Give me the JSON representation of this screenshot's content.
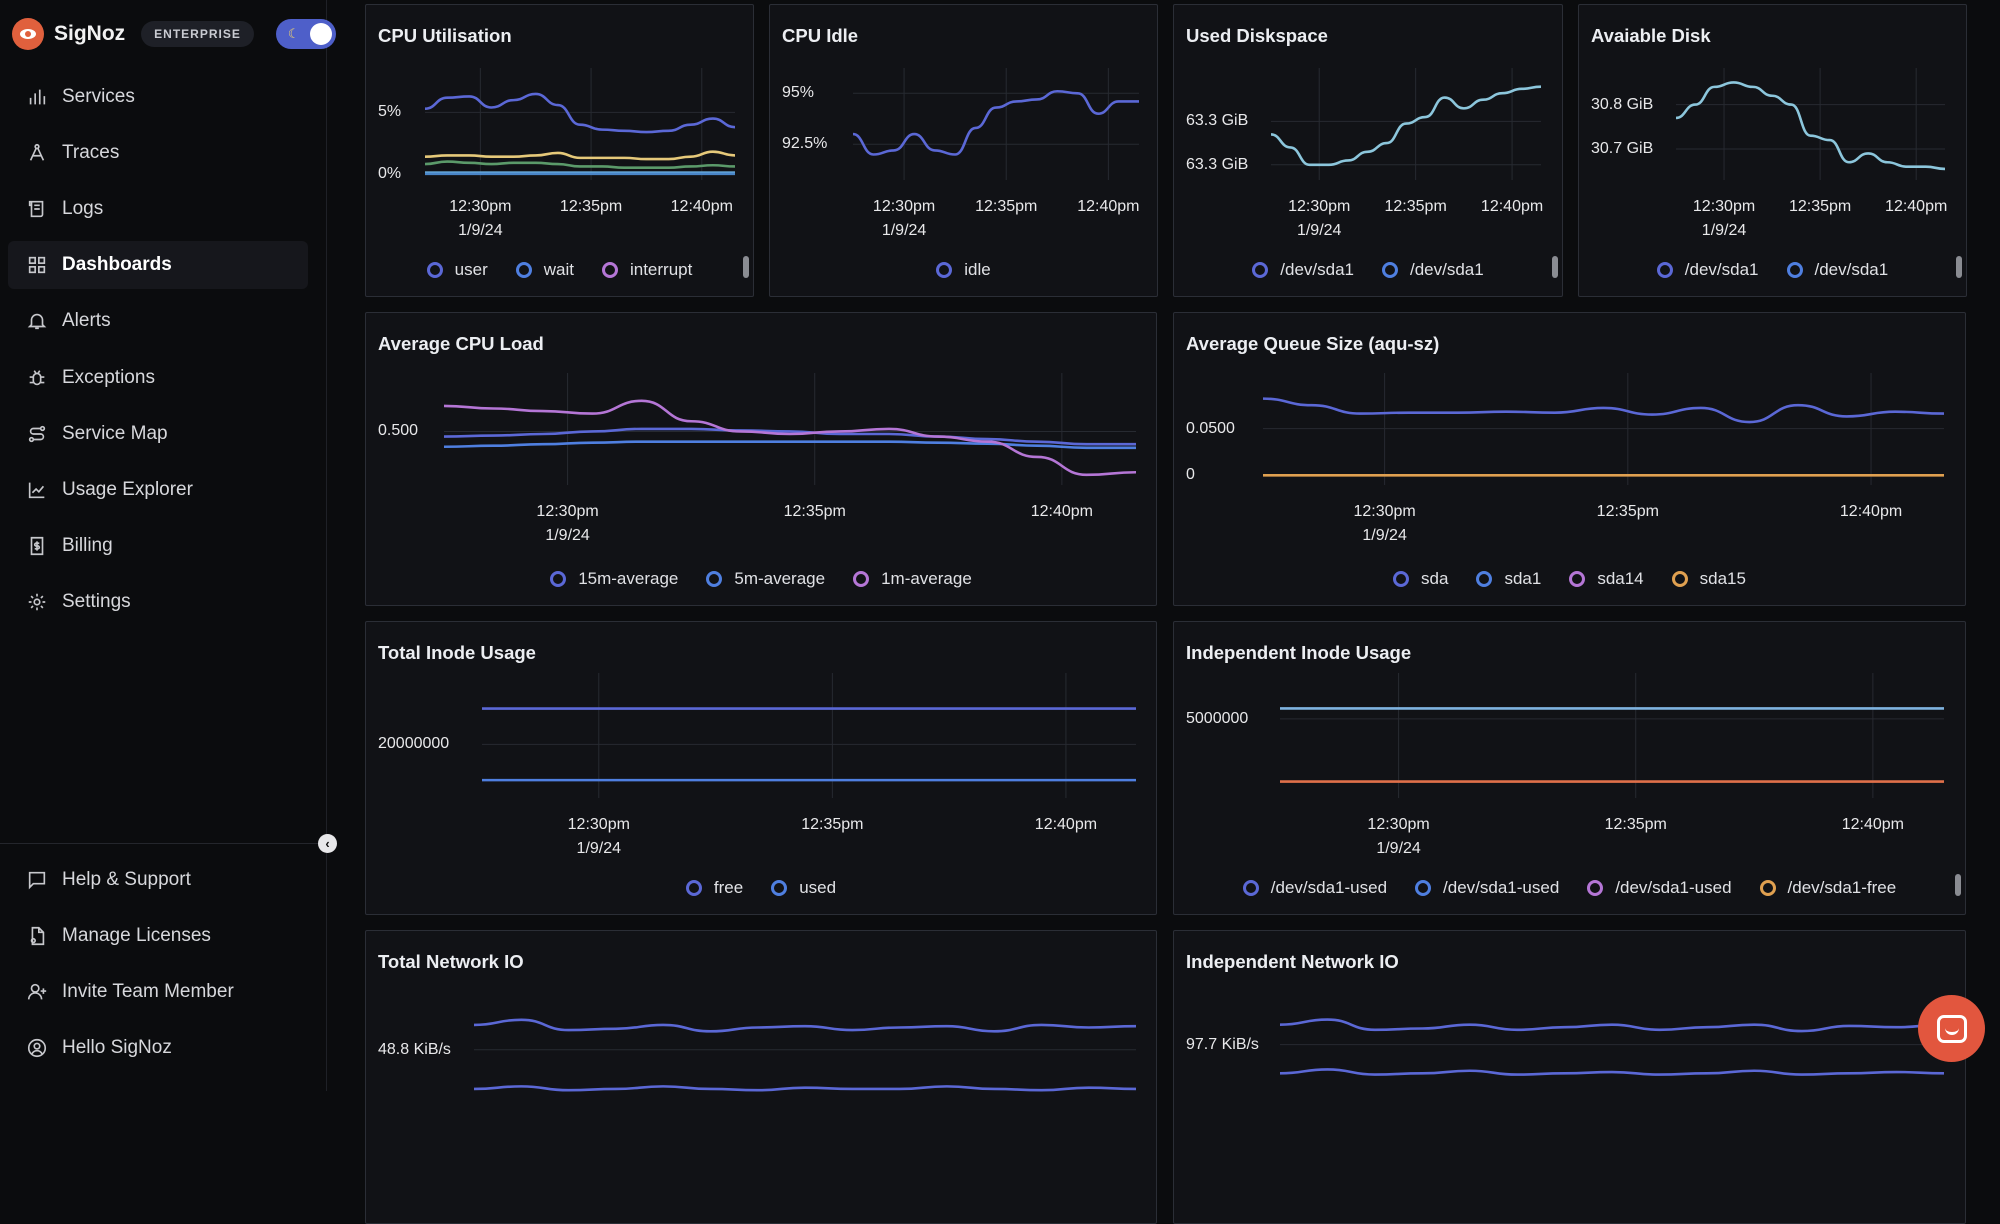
{
  "app": {
    "name": "SigNoz",
    "edition_badge": "ENTERPRISE",
    "theme_toggle_on": true
  },
  "sidebar": {
    "items": [
      {
        "label": "Services",
        "icon": "bar-chart-icon"
      },
      {
        "label": "Traces",
        "icon": "traces-icon"
      },
      {
        "label": "Logs",
        "icon": "scroll-icon"
      },
      {
        "label": "Dashboards",
        "icon": "grid-icon",
        "active": true
      },
      {
        "label": "Alerts",
        "icon": "bell-icon"
      },
      {
        "label": "Exceptions",
        "icon": "bug-icon"
      },
      {
        "label": "Service Map",
        "icon": "route-icon"
      },
      {
        "label": "Usage Explorer",
        "icon": "line-chart-icon"
      },
      {
        "label": "Billing",
        "icon": "receipt-icon"
      },
      {
        "label": "Settings",
        "icon": "gear-icon"
      }
    ],
    "bottom_items": [
      {
        "label": "Help & Support",
        "icon": "message-icon"
      },
      {
        "label": "Manage Licenses",
        "icon": "license-icon"
      },
      {
        "label": "Invite Team Member",
        "icon": "user-plus-icon"
      },
      {
        "label": "Hello SigNoz",
        "icon": "user-circle-icon"
      }
    ]
  },
  "colors": {
    "accent": "#4e5fc9",
    "brand": "#e0603d",
    "panel_bg": "#111216",
    "border": "#2b2e36"
  },
  "chart_data": [
    {
      "type": "line",
      "title": "CPU Utilisation",
      "xlim": [
        "12:27:30",
        "12:41:30"
      ],
      "ylim": [
        -0.5,
        7.8
      ],
      "yticks": [
        {
          "value": 5,
          "label": "5%"
        },
        {
          "value": 0,
          "label": "0%"
        }
      ],
      "xticks": [
        {
          "value": "12:30",
          "label": "12:30pm",
          "sub": "1/9/24"
        },
        {
          "value": "12:35",
          "label": "12:35pm"
        },
        {
          "value": "12:40",
          "label": "12:40pm"
        }
      ],
      "legend": [
        {
          "name": "user",
          "color": "#5b68d6"
        },
        {
          "name": "wait",
          "color": "#4f7fe0"
        },
        {
          "name": "interrupt",
          "color": "#b576d6"
        }
      ],
      "legend_scroll": true,
      "series": [
        {
          "color": "#5b68d6",
          "values": [
            5.3,
            6.2,
            6.3,
            5.4,
            6.0,
            6.5,
            5.6,
            4.0,
            3.6,
            3.5,
            3.4,
            3.5,
            4.0,
            4.5,
            3.8
          ]
        },
        {
          "color": "#e6c97a",
          "values": [
            1.4,
            1.5,
            1.5,
            1.4,
            1.4,
            1.5,
            1.7,
            1.3,
            1.3,
            1.3,
            1.2,
            1.2,
            1.4,
            1.8,
            1.5
          ]
        },
        {
          "color": "#5b9a6a",
          "values": [
            0.8,
            1.0,
            0.9,
            0.8,
            0.9,
            0.9,
            0.8,
            0.6,
            0.6,
            0.5,
            0.5,
            0.5,
            0.6,
            0.7,
            0.6
          ]
        },
        {
          "color": "#6fb6e8",
          "values": [
            0.1,
            0.1,
            0.1,
            0.1,
            0.1,
            0.1,
            0.1,
            0.1,
            0.1,
            0.1,
            0.1,
            0.1,
            0.1,
            0.1,
            0.1
          ]
        },
        {
          "color": "#4a86c8",
          "values": [
            0,
            0,
            0,
            0,
            0,
            0,
            0,
            0,
            0,
            0,
            0,
            0,
            0,
            0,
            0
          ]
        }
      ]
    },
    {
      "type": "line",
      "title": "CPU Idle",
      "xlim": [
        "12:27:30",
        "12:41:30"
      ],
      "ylim": [
        90.75,
        95.75
      ],
      "yticks": [
        {
          "value": 95,
          "label": "95%"
        },
        {
          "value": 92.5,
          "label": "92.5%"
        }
      ],
      "xticks": [
        {
          "value": "12:30",
          "label": "12:30pm",
          "sub": "1/9/24"
        },
        {
          "value": "12:35",
          "label": "12:35pm"
        },
        {
          "value": "12:40",
          "label": "12:40pm"
        }
      ],
      "legend": [
        {
          "name": "idle",
          "color": "#5b68d6"
        }
      ],
      "series": [
        {
          "color": "#5b68d6",
          "values": [
            93.0,
            92.0,
            92.2,
            93.0,
            92.2,
            92.0,
            93.3,
            94.3,
            94.6,
            94.7,
            95.1,
            95.0,
            94.0,
            94.6,
            94.6
          ]
        }
      ]
    },
    {
      "type": "line",
      "title": "Used Diskspace",
      "xlim": [
        "12:27:30",
        "12:41:30"
      ],
      "ylim": [
        63.293,
        63.34
      ],
      "yticks": [
        {
          "value": 63.32,
          "label": "63.3 GiB"
        },
        {
          "value": 63.3,
          "label": "63.3 GiB"
        }
      ],
      "xticks": [
        {
          "value": "12:30",
          "label": "12:30pm",
          "sub": "1/9/24"
        },
        {
          "value": "12:35",
          "label": "12:35pm"
        },
        {
          "value": "12:40",
          "label": "12:40pm"
        }
      ],
      "legend": [
        {
          "name": "/dev/sda1",
          "color": "#5b68d6"
        },
        {
          "name": "/dev/sda1",
          "color": "#4f7fe0"
        }
      ],
      "legend_scroll": true,
      "series": [
        {
          "color": "#8cc6dc",
          "values": [
            63.314,
            63.308,
            63.3,
            63.3,
            63.302,
            63.306,
            63.31,
            63.319,
            63.322,
            63.331,
            63.326,
            63.33,
            63.333,
            63.335,
            63.336
          ]
        }
      ]
    },
    {
      "type": "line",
      "title": "Avaiable Disk",
      "xlim": [
        "12:27:30",
        "12:41:30"
      ],
      "ylim": [
        30.63,
        30.86
      ],
      "yticks": [
        {
          "value": 30.8,
          "label": "30.8 GiB"
        },
        {
          "value": 30.7,
          "label": "30.7 GiB"
        }
      ],
      "xticks": [
        {
          "value": "12:30",
          "label": "12:30pm",
          "sub": "1/9/24"
        },
        {
          "value": "12:35",
          "label": "12:35pm"
        },
        {
          "value": "12:40",
          "label": "12:40pm"
        }
      ],
      "legend": [
        {
          "name": "/dev/sda1",
          "color": "#5b68d6"
        },
        {
          "name": "/dev/sda1",
          "color": "#4f7fe0"
        }
      ],
      "legend_scroll": true,
      "series": [
        {
          "color": "#8cc6dc",
          "values": [
            30.77,
            30.8,
            30.84,
            30.85,
            30.84,
            30.82,
            30.8,
            30.73,
            30.72,
            30.67,
            30.69,
            30.67,
            30.66,
            30.66,
            30.655
          ]
        }
      ]
    },
    {
      "type": "line",
      "title": "Average CPU Load",
      "xlim": [
        "12:27:30",
        "12:41:30"
      ],
      "ylim": [
        0.395,
        0.595
      ],
      "yticks": [
        {
          "value": 0.5,
          "label": "0.500"
        }
      ],
      "xticks": [
        {
          "value": "12:30",
          "label": "12:30pm",
          "sub": "1/9/24"
        },
        {
          "value": "12:35",
          "label": "12:35pm"
        },
        {
          "value": "12:40",
          "label": "12:40pm"
        }
      ],
      "legend": [
        {
          "name": "15m-average",
          "color": "#5b68d6"
        },
        {
          "name": "5m-average",
          "color": "#4f7fe0"
        },
        {
          "name": "1m-average",
          "color": "#b576d6"
        }
      ],
      "series": [
        {
          "color": "#5b68d6",
          "values": [
            0.49,
            0.492,
            0.495,
            0.5,
            0.505,
            0.505,
            0.502,
            0.5,
            0.495,
            0.495,
            0.49,
            0.485,
            0.48,
            0.475,
            0.475
          ]
        },
        {
          "color": "#4f7fe0",
          "values": [
            0.47,
            0.472,
            0.475,
            0.478,
            0.48,
            0.48,
            0.48,
            0.48,
            0.48,
            0.48,
            0.478,
            0.476,
            0.472,
            0.468,
            0.468
          ]
        },
        {
          "color": "#b576d6",
          "values": [
            0.55,
            0.545,
            0.54,
            0.535,
            0.56,
            0.52,
            0.5,
            0.495,
            0.5,
            0.505,
            0.49,
            0.48,
            0.45,
            0.415,
            0.42
          ]
        }
      ]
    },
    {
      "type": "line",
      "title": "Average Queue Size (aqu-sz)",
      "xlim": [
        "12:27:30",
        "12:41:30"
      ],
      "ylim": [
        -0.0103,
        0.0987
      ],
      "yticks": [
        {
          "value": 0.05,
          "label": "0.0500"
        },
        {
          "value": 0,
          "label": "0"
        }
      ],
      "xticks": [
        {
          "value": "12:30",
          "label": "12:30pm",
          "sub": "1/9/24"
        },
        {
          "value": "12:35",
          "label": "12:35pm"
        },
        {
          "value": "12:40",
          "label": "12:40pm"
        }
      ],
      "legend": [
        {
          "name": "sda",
          "color": "#5b68d6"
        },
        {
          "name": "sda1",
          "color": "#4f7fe0"
        },
        {
          "name": "sda14",
          "color": "#b576d6"
        },
        {
          "name": "sda15",
          "color": "#e0a050"
        }
      ],
      "series": [
        {
          "color": "#5b68d6",
          "values": [
            0.082,
            0.075,
            0.066,
            0.067,
            0.067,
            0.068,
            0.067,
            0.072,
            0.065,
            0.072,
            0.057,
            0.075,
            0.063,
            0.068,
            0.066
          ]
        },
        {
          "color": "#e0a050",
          "values": [
            0,
            0,
            0,
            0,
            0,
            0,
            0,
            0,
            0,
            0,
            0,
            0,
            0,
            0,
            0
          ]
        }
      ]
    },
    {
      "type": "line",
      "title": "Total Inode Usage",
      "xlim": [
        "12:27:30",
        "12:41:30"
      ],
      "ylim": [
        17000000,
        23430000
      ],
      "yticks": [
        {
          "value": 20000000,
          "label": "20000000"
        }
      ],
      "xticks": [
        {
          "value": "12:30",
          "label": "12:30pm",
          "sub": "1/9/24"
        },
        {
          "value": "12:35",
          "label": "12:35pm"
        },
        {
          "value": "12:40",
          "label": "12:40pm"
        }
      ],
      "legend": [
        {
          "name": "free",
          "color": "#5b68d6"
        },
        {
          "name": "used",
          "color": "#4f7fe0"
        }
      ],
      "series": [
        {
          "color": "#5b68d6",
          "values": [
            22000000,
            22000000,
            22000000,
            22000000,
            22000000,
            22000000,
            22000000,
            22000000,
            22000000,
            22000000,
            22000000,
            22000000,
            22000000,
            22000000,
            22000000
          ]
        },
        {
          "color": "#4f7fe0",
          "values": [
            18000000,
            18000000,
            18000000,
            18000000,
            18000000,
            18000000,
            18000000,
            18000000,
            18000000,
            18000000,
            18000000,
            18000000,
            18000000,
            18000000,
            18000000
          ]
        }
      ]
    },
    {
      "type": "line",
      "title": "Independent Inode Usage",
      "xlim": [
        "12:27:30",
        "12:41:30"
      ],
      "ylim": [
        2790000,
        6000000
      ],
      "yticks": [
        {
          "value": 5000000,
          "label": "5000000"
        }
      ],
      "xticks": [
        {
          "value": "12:30",
          "label": "12:30pm",
          "sub": "1/9/24"
        },
        {
          "value": "12:35",
          "label": "12:35pm"
        },
        {
          "value": "12:40",
          "label": "12:40pm"
        }
      ],
      "legend": [
        {
          "name": "/dev/sda1-used",
          "color": "#5b68d6"
        },
        {
          "name": "/dev/sda1-used",
          "color": "#4f7fe0"
        },
        {
          "name": "/dev/sda1-used",
          "color": "#b576d6"
        },
        {
          "name": "/dev/sda1-free",
          "color": "#e0a050"
        }
      ],
      "legend_scroll": true,
      "series": [
        {
          "color": "#7fb3e0",
          "values": [
            5290000,
            5290000,
            5290000,
            5290000,
            5290000,
            5290000,
            5290000,
            5290000,
            5290000,
            5290000,
            5290000,
            5290000,
            5290000,
            5290000,
            5290000
          ]
        },
        {
          "color": "#e0704a",
          "values": [
            3250000,
            3250000,
            3250000,
            3250000,
            3250000,
            3250000,
            3250000,
            3250000,
            3250000,
            3250000,
            3250000,
            3250000,
            3250000,
            3250000,
            3250000
          ]
        }
      ]
    },
    {
      "type": "line",
      "title": "Total Network IO",
      "xlim": [
        "12:27:30",
        "12:41:30"
      ],
      "ylim": [
        32.3,
        69.8
      ],
      "yticks": [
        {
          "value": 48.8,
          "label": "48.8 KiB/s"
        }
      ],
      "xticks": [],
      "legend": [],
      "series": [
        {
          "color": "#5b68d6",
          "values": [
            58.5,
            60.5,
            56.5,
            57.0,
            58.5,
            56.0,
            57.5,
            58.0,
            56.5,
            57.5,
            58.0,
            56.0,
            58.5,
            57.5,
            58.0
          ]
        },
        {
          "color": "#5b68d6",
          "values": [
            33.5,
            34.5,
            33.0,
            33.5,
            34.5,
            33.5,
            33.0,
            34.0,
            33.5,
            33.5,
            34.5,
            33.5,
            33.0,
            34.0,
            33.5
          ]
        }
      ]
    },
    {
      "type": "line",
      "title": "Independent Network IO",
      "xlim": [
        "12:27:30",
        "12:41:30"
      ],
      "ylim": [
        79.2,
        116.7
      ],
      "yticks": [
        {
          "value": 97.7,
          "label": "97.7 KiB/s"
        }
      ],
      "xticks": [],
      "legend": [],
      "series": [
        {
          "color": "#5b68d6",
          "values": [
            105.5,
            107.5,
            103.5,
            104.0,
            105.5,
            103.5,
            104.5,
            105.5,
            103.5,
            104.5,
            105.5,
            103.0,
            105.0,
            104.5,
            105.5
          ]
        },
        {
          "color": "#5b68d6",
          "values": [
            86.5,
            88.0,
            86.0,
            86.5,
            87.5,
            86.0,
            86.5,
            87.0,
            86.0,
            86.5,
            87.5,
            86.0,
            86.5,
            87.0,
            86.5
          ]
        }
      ]
    }
  ]
}
